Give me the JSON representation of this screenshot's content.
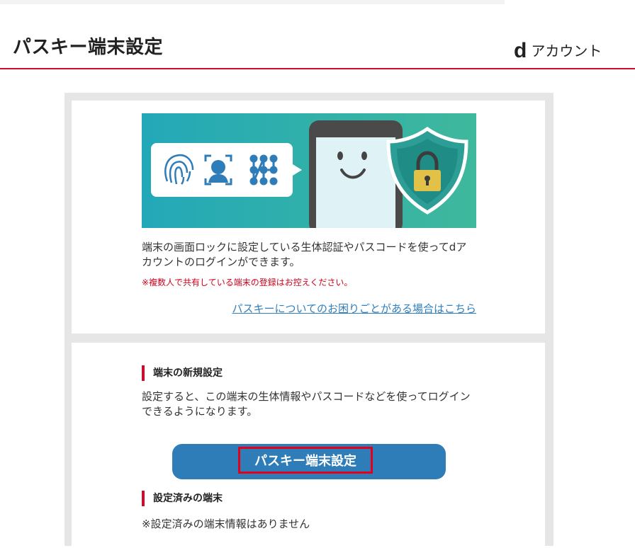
{
  "header": {
    "title": "パスキー端末設定",
    "brand_mark": "d",
    "brand_text": "アカウント"
  },
  "intro": {
    "description": "端末の画面ロックに設定している生体認証やパスコードを使ってdアカウントのログインができます。",
    "warning": "※複数人で共有している端末の登録はお控えください。",
    "help_link": "パスキーについてのお困りごとがある場合はこちら"
  },
  "new_setup": {
    "heading": "端末の新規設定",
    "description": "設定すると、この端末の生体情報やパスコードなどを使ってログインできるようになります。",
    "button_label": "パスキー端末設定"
  },
  "configured": {
    "heading": "設定済みの端末",
    "none_text": "※設定済みの端末情報はありません"
  },
  "colors": {
    "accent_red": "#c8102e",
    "button_blue": "#2e7cb8",
    "link_blue": "#2f7fbf",
    "banner_teal": "#2ab0b8"
  }
}
